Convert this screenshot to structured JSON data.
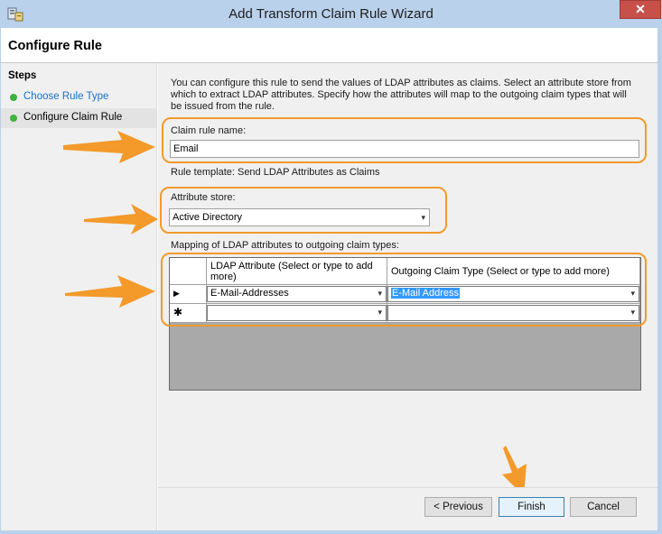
{
  "window": {
    "title": "Add Transform Claim Rule Wizard",
    "close_glyph": "✕"
  },
  "header": {
    "title": "Configure Rule"
  },
  "sidebar": {
    "title": "Steps",
    "items": [
      {
        "label": "Choose Rule Type",
        "state": "link",
        "color": "#1a6fc9"
      },
      {
        "label": "Configure Claim Rule",
        "state": "current",
        "color": "#000000"
      }
    ]
  },
  "content": {
    "intro": "You can configure this rule to send the values of LDAP attributes as claims. Select an attribute store from which to extract LDAP attributes. Specify how the attributes will map to the outgoing claim types that will be issued from the rule.",
    "claim_rule_name_label": "Claim rule name:",
    "claim_rule_name_value": "Email",
    "rule_template": "Rule template: Send LDAP Attributes as Claims",
    "attribute_store_label": "Attribute store:",
    "attribute_store_value": "Active Directory",
    "mapping_label": "Mapping of LDAP attributes to outgoing claim types:",
    "grid": {
      "col_ldap": "LDAP Attribute (Select or type to add more)",
      "col_claim": "Outgoing Claim Type (Select or type to add more)",
      "rows": [
        {
          "marker": "▶",
          "ldap": "E-Mail-Addresses",
          "claim": "E-Mail Address"
        },
        {
          "marker": "✱",
          "ldap": "",
          "claim": ""
        }
      ]
    }
  },
  "footer": {
    "previous": "< Previous",
    "finish": "Finish",
    "cancel": "Cancel"
  },
  "icons": {
    "app_icon": "server-icon",
    "chevron": "▾",
    "annotation_color": "#f39a2b"
  }
}
